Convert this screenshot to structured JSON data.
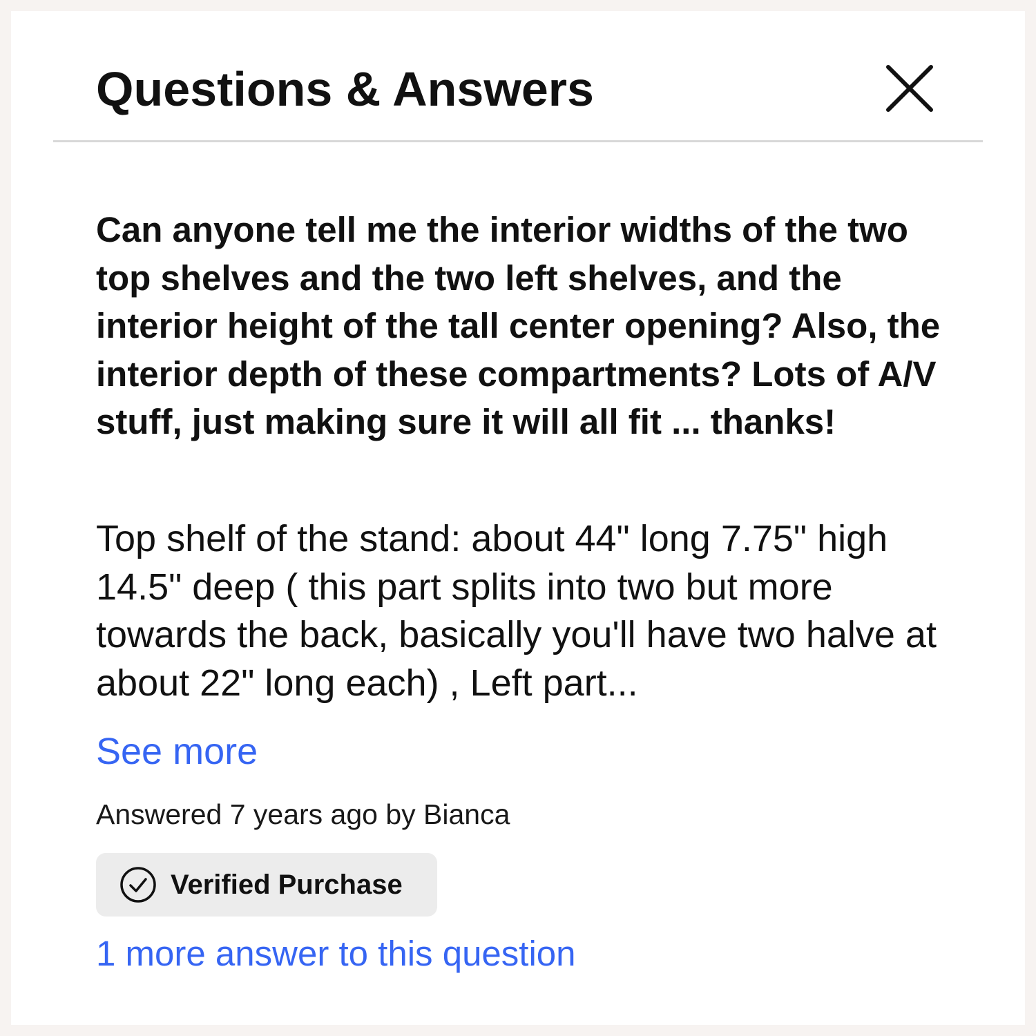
{
  "header": {
    "title": "Questions & Answers",
    "close_icon": "close-icon"
  },
  "question": {
    "text": "Can anyone tell me the interior widths of the two top shelves and the two left shelves, and the interior height of the tall center opening? Also, the interior depth of these compartments? Lots of A/V stuff, just making sure it will all fit ... thanks!"
  },
  "answer": {
    "text": "Top shelf of the stand: about 44\" long 7.75\" high 14.5\" deep ( this part splits into two but more towards the back, basically you'll have two halve at about 22\" long each) , Left part...",
    "see_more_label": "See more",
    "meta": "Answered 7 years ago by Bianca",
    "badge": {
      "icon": "check-circle-icon",
      "label": "Verified Purchase"
    }
  },
  "more_answers_label": "1 more answer to this question",
  "colors": {
    "link": "#3665f3",
    "text": "#111111",
    "divider": "#d8d8d8",
    "badge_background": "#ececec",
    "page_background": "#f7f3f1"
  }
}
